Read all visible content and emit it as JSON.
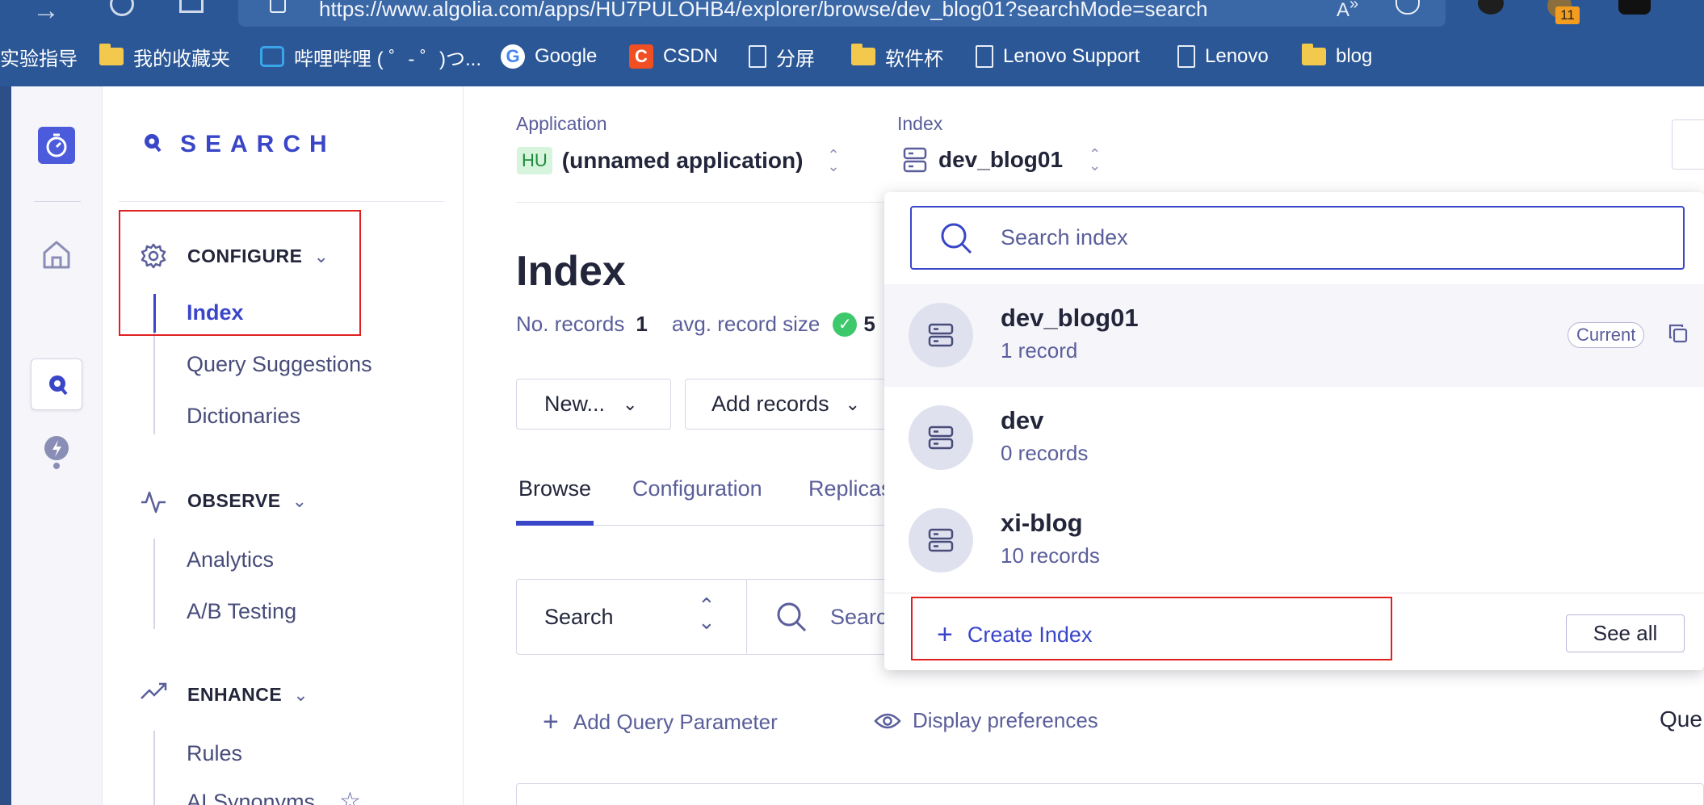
{
  "browser": {
    "url": "https://www.algolia.com/apps/HU7PULOHB4/explorer/browse/dev_blog01?searchMode=search",
    "badge_count": "11",
    "bookmarks": [
      "实验指导",
      "我的收藏夹",
      "哔哩哔哩 ( ゜- ゜)つ...",
      "Google",
      "CSDN",
      "分屏",
      "软件杯",
      "Lenovo Support",
      "Lenovo",
      "blog"
    ]
  },
  "brand": {
    "name": "SEARCH"
  },
  "nav": {
    "configure": {
      "label": "CONFIGURE",
      "items": [
        "Index",
        "Query Suggestions",
        "Dictionaries"
      ]
    },
    "observe": {
      "label": "OBSERVE",
      "items": [
        "Analytics",
        "A/B Testing"
      ]
    },
    "enhance": {
      "label": "ENHANCE",
      "items": [
        "Rules",
        "AI Synonyms"
      ]
    }
  },
  "header": {
    "application_label": "Application",
    "app_badge": "HU",
    "app_name": "(unnamed application)",
    "index_label": "Index",
    "index_name": "dev_blog01"
  },
  "main": {
    "title": "Index",
    "records_label": "No. records",
    "records_value": "1",
    "avg_size_label": "avg. record size",
    "avg_size_value": "5",
    "new_button": "New...",
    "add_records_button": "Add records",
    "tabs": [
      "Browse",
      "Configuration",
      "Replicas"
    ],
    "search_mode": "Search",
    "search_placeholder": "Search",
    "add_query_param": "Add Query Parameter",
    "display_prefs": "Display preferences",
    "right_cut_text": "Que"
  },
  "dropdown": {
    "search_placeholder": "Search index",
    "current_badge": "Current",
    "items": [
      {
        "name": "dev_blog01",
        "records": "1 record"
      },
      {
        "name": "dev",
        "records": "0 records"
      },
      {
        "name": "xi-blog",
        "records": "10 records"
      }
    ],
    "create_label": "Create Index",
    "see_all": "See all"
  },
  "colors": {
    "accent": "#3a46c8",
    "chrome": "#2b5797",
    "highlight_box": "#e02020",
    "success": "#3dc96b"
  }
}
